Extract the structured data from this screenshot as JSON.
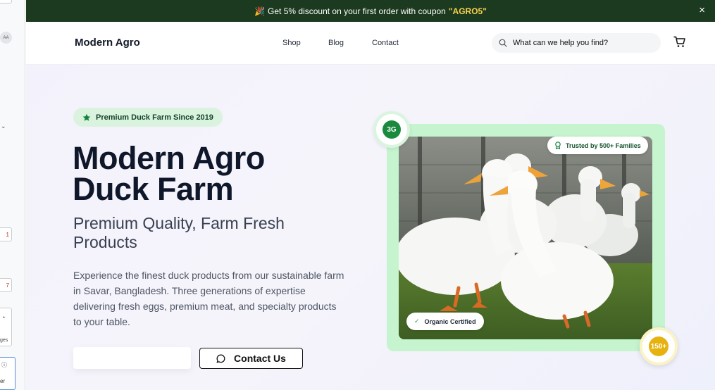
{
  "browser_sidebar": {
    "avatar_initials": "AA",
    "badge_1": "1",
    "badge_2": "7",
    "mini_label": "ges",
    "blue_label": "er"
  },
  "promo": {
    "emoji": "🎉",
    "text": "Get 5% discount on your first order with coupon",
    "code": "\"AGRO5\"",
    "close": "×"
  },
  "header": {
    "logo": "Modern Agro",
    "nav": [
      "Shop",
      "Blog",
      "Contact"
    ],
    "search_placeholder": "What can we help you find?"
  },
  "hero": {
    "badge": "Premium Duck Farm Since 2019",
    "title_line1": "Modern Agro",
    "title_line2": "Duck Farm",
    "subtitle": "Premium Quality, Farm Fresh Products",
    "description": "Experience the finest duck products from our sustainable farm in Savar, Bangladesh. Three generations of expertise delivering fresh eggs, premium meat, and specialty products to your table.",
    "contact_button": "Contact Us"
  },
  "image_card": {
    "generations_badge": "3G",
    "trusted_badge": "Trusted by 500+ Families",
    "organic_badge": "Organic Certified",
    "organic_check": "✓",
    "products_badge": "150+"
  },
  "colors": {
    "promo_bg": "#1c3a1f",
    "promo_code": "#f7d14c",
    "accent_green": "#1a8a3c",
    "card_green": "#c6f4cf",
    "gold": "#e6b20e"
  }
}
